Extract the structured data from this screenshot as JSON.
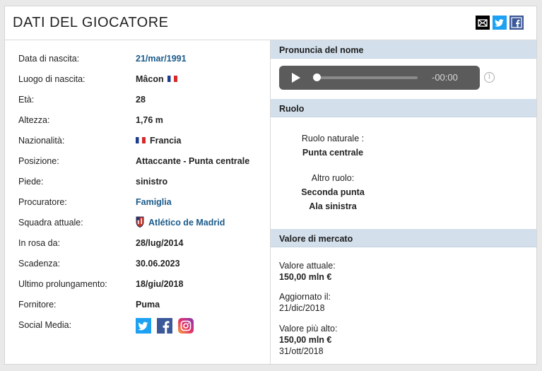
{
  "header": {
    "title": "DATI DEL GIOCATORE",
    "share": [
      {
        "icon": "mail-icon",
        "color": "#000000"
      },
      {
        "icon": "twitter-icon",
        "color": "#1da1f2"
      },
      {
        "icon": "facebook-icon",
        "color": "#3b5998"
      }
    ]
  },
  "details": [
    {
      "label": "Data di nascita:",
      "value": "21/mar/1991",
      "link": true
    },
    {
      "label": "Luogo di nascita:",
      "value": "Mâcon",
      "flag_after": "france-flag-icon"
    },
    {
      "label": "Età:",
      "value": "28"
    },
    {
      "label": "Altezza:",
      "value": "1,76 m"
    },
    {
      "label": "Nazionalità:",
      "value": "Francia",
      "flag_before": "france-flag-icon"
    },
    {
      "label": "Posizione:",
      "value": "Attaccante - Punta centrale"
    },
    {
      "label": "Piede:",
      "value": "sinistro"
    },
    {
      "label": "Procuratore:",
      "value": "Famiglia",
      "link": true
    },
    {
      "label": "Squadra attuale:",
      "value": "Atlético de Madrid",
      "link": true,
      "icon": "club-crest-icon"
    },
    {
      "label": "In rosa da:",
      "value": "28/lug/2014"
    },
    {
      "label": "Scadenza:",
      "value": "30.06.2023"
    },
    {
      "label": "Ultimo prolungamento:",
      "value": "18/giu/2018"
    },
    {
      "label": "Fornitore:",
      "value": "Puma"
    },
    {
      "label": "Social Media:",
      "social": [
        "twitter-icon",
        "facebook-icon",
        "instagram-icon"
      ]
    }
  ],
  "pronuncia": {
    "title": "Pronuncia del nome",
    "time": "-00:00"
  },
  "ruolo": {
    "title": "Ruolo",
    "natural_label": "Ruolo naturale :",
    "natural_value": "Punta centrale",
    "other_label": "Altro ruolo:",
    "other_values": [
      "Seconda punta",
      "Ala sinistra"
    ]
  },
  "valore": {
    "title": "Valore di mercato",
    "current_label": "Valore attuale:",
    "current_value": "150,00 mln €",
    "updated_label": "Aggiornato il:",
    "updated_value": "21/dic/2018",
    "highest_label": "Valore più alto:",
    "highest_value": "150,00 mln €",
    "highest_date": "31/ott/2018"
  }
}
